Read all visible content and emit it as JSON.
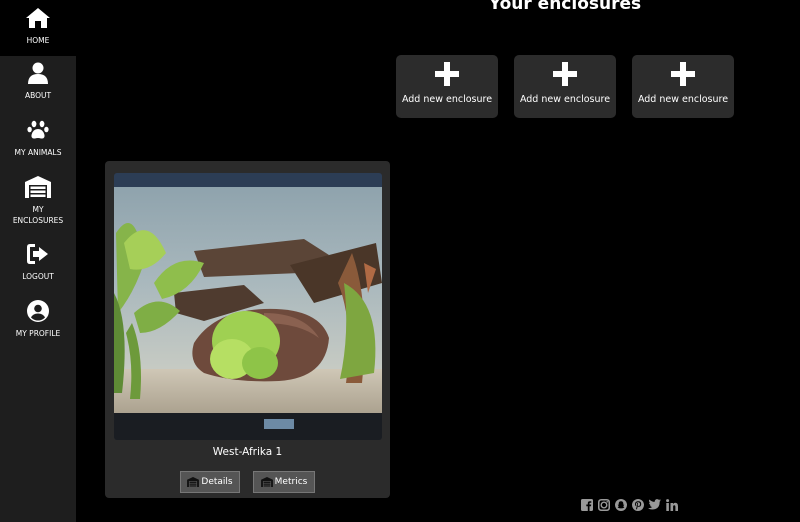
{
  "sidebar": {
    "items": [
      {
        "label": "HOME",
        "icon": "home-icon"
      },
      {
        "label": "ABOUT",
        "icon": "user-icon"
      },
      {
        "label": "MY ANIMALS",
        "icon": "paw-icon"
      },
      {
        "label": "MY ENCLOSURES",
        "icon": "warehouse-icon"
      },
      {
        "label": "LOGOUT",
        "icon": "sign-out-icon"
      },
      {
        "label": "MY PROFILE",
        "icon": "user-circle-icon"
      }
    ]
  },
  "main": {
    "title": "Your enclosures",
    "add_buttons": [
      {
        "label": "Add new enclosure",
        "icon": "plus-icon"
      },
      {
        "label": "Add new enclosure",
        "icon": "plus-icon"
      },
      {
        "label": "Add new enclosure",
        "icon": "plus-icon"
      }
    ],
    "enclosures": [
      {
        "name": "West-Afrika 1",
        "details_label": "Details",
        "metrics_label": "Metrics"
      }
    ]
  },
  "footer": {
    "social": [
      "facebook-icon",
      "instagram-icon",
      "snapchat-icon",
      "pinterest-icon",
      "twitter-icon",
      "linkedin-icon"
    ]
  },
  "colors": {
    "background": "#000000",
    "sidebar": "#1e1e1e",
    "card": "#2b2b2b",
    "button": "#2c2c2c"
  }
}
